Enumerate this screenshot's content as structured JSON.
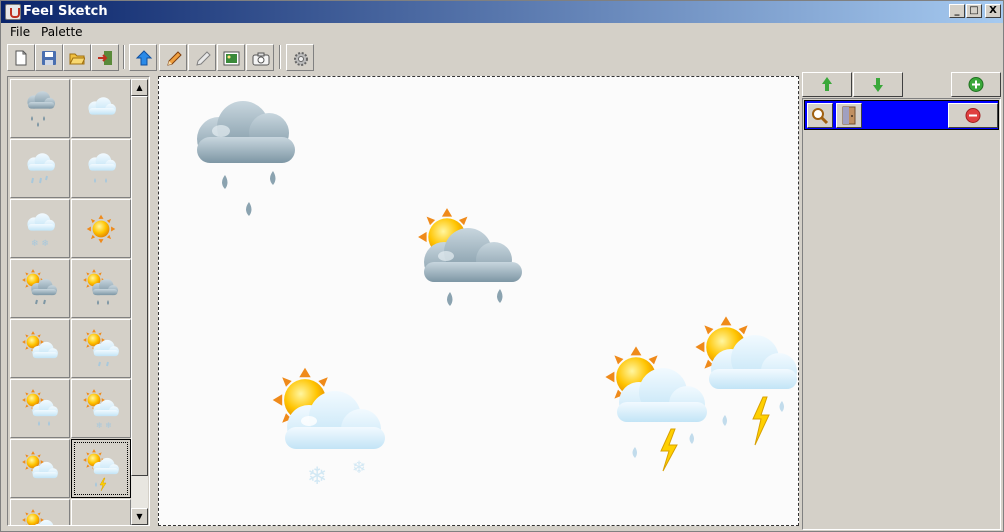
{
  "window": {
    "title": "Feel Sketch"
  },
  "titlebar": {
    "minimize_label": "_",
    "maximize_label": "□",
    "close_label": "X"
  },
  "menu": [
    {
      "label": "File"
    },
    {
      "label": "Palette"
    }
  ],
  "toolbar": {
    "tools": [
      "new-file-icon",
      "save-icon",
      "open-folder-icon",
      "exit-icon",
      "arrow-icon",
      "pencil-icon",
      "eraser-icon",
      "image-icon",
      "camera-icon",
      "settings-icon"
    ]
  },
  "palette": {
    "cells": [
      "rain-cloud",
      "cloud",
      "cloud-showers",
      "cloud-drizzle",
      "cloud-snow",
      "sun",
      "sun-rain-cloud",
      "sun-storm-cloud",
      "sun-cloud",
      "sun-cloud-rain",
      "sun-cloud-drops",
      "sun-cloud-snow",
      "sun-cloud-light",
      "sun-cloud-thunder",
      "sun-cloud-partial",
      ""
    ],
    "selected_index": 13
  },
  "scrollbar": {
    "up_label": "▲",
    "down_label": "▼"
  },
  "right_panel": {
    "up_icon": "up-arrow-icon",
    "down_icon": "down-arrow-icon",
    "add_icon": "add-icon",
    "layer": {
      "zoom_icon": "magnifier-icon",
      "door_icon": "door-icon",
      "remove_icon": "remove-icon"
    }
  },
  "colors": {
    "accent": "#0a246a",
    "layer_selected": "#0000ff",
    "face": "#d4d0c8"
  }
}
